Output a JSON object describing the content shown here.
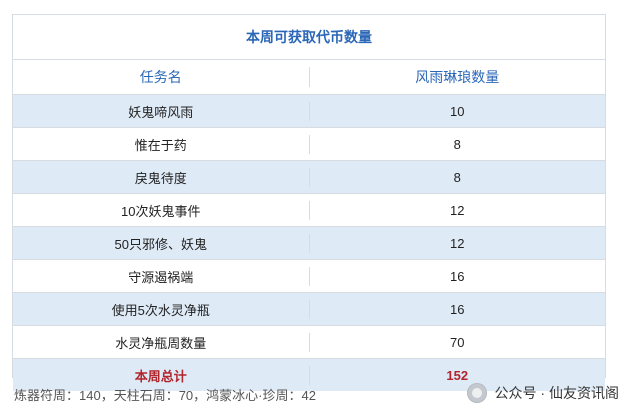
{
  "table": {
    "title": "本周可获取代币数量",
    "headers": [
      "任务名",
      "风雨琳琅数量"
    ],
    "rows": [
      {
        "task": "妖鬼啼风雨",
        "amount": "10"
      },
      {
        "task": "惟在于药",
        "amount": "8"
      },
      {
        "task": "戾鬼待度",
        "amount": "8"
      },
      {
        "task": "10次妖鬼事件",
        "amount": "12"
      },
      {
        "task": "50只邪修、妖鬼",
        "amount": "12"
      },
      {
        "task": "守源遏祸端",
        "amount": "16"
      },
      {
        "task": "使用5次水灵净瓶",
        "amount": "16"
      },
      {
        "task": "水灵净瓶周数量",
        "amount": "70"
      }
    ],
    "total": {
      "label": "本周总计",
      "amount": "152"
    }
  },
  "footnote": "炼器符周：140，天柱石周：70，鸿蒙冰心·珍周：42",
  "watermark": {
    "text": "公众号 · 仙友资讯阁",
    "icon": "wechat-icon"
  }
}
